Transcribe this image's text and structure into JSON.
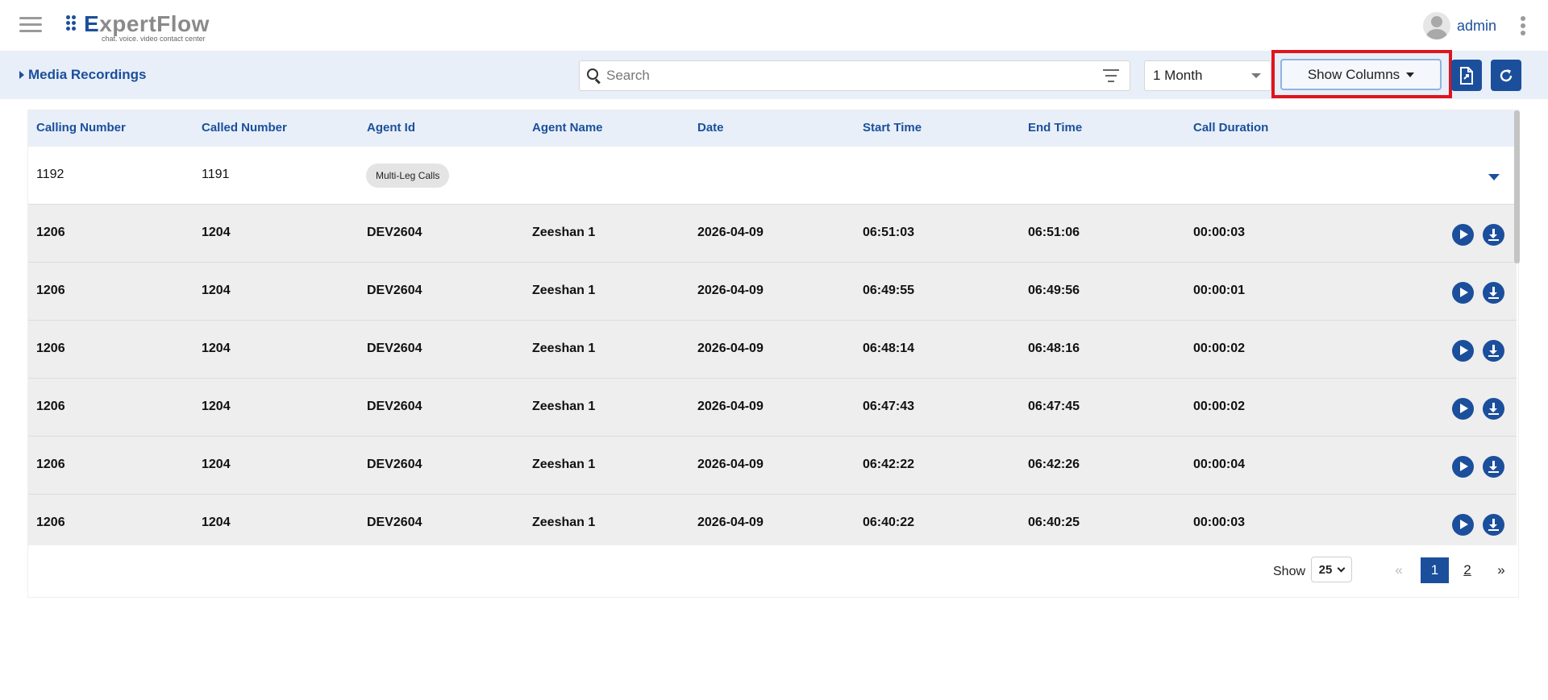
{
  "header": {
    "brand": "ExpertFlow",
    "brand_e": "E",
    "brand_rest": "xpertFlow",
    "tagline": "chat. voice. video contact center",
    "username": "admin"
  },
  "toolbar": {
    "breadcrumb": "Media Recordings",
    "search_placeholder": "Search",
    "period": "1 Month",
    "show_columns": "Show Columns"
  },
  "table": {
    "columns": [
      "Calling Number",
      "Called Number",
      "Agent Id",
      "Agent Name",
      "Date",
      "Start Time",
      "End Time",
      "Call Duration"
    ],
    "group_row": {
      "calling": "1192",
      "called": "1191",
      "tag": "Multi-Leg Calls"
    },
    "rows": [
      {
        "calling": "1206",
        "called": "1204",
        "agent_id": "DEV2604",
        "agent_name": "Zeeshan 1",
        "date": "2026-04-09",
        "start": "06:51:03",
        "end": "06:51:06",
        "duration": "00:00:03"
      },
      {
        "calling": "1206",
        "called": "1204",
        "agent_id": "DEV2604",
        "agent_name": "Zeeshan 1",
        "date": "2026-04-09",
        "start": "06:49:55",
        "end": "06:49:56",
        "duration": "00:00:01"
      },
      {
        "calling": "1206",
        "called": "1204",
        "agent_id": "DEV2604",
        "agent_name": "Zeeshan 1",
        "date": "2026-04-09",
        "start": "06:48:14",
        "end": "06:48:16",
        "duration": "00:00:02"
      },
      {
        "calling": "1206",
        "called": "1204",
        "agent_id": "DEV2604",
        "agent_name": "Zeeshan 1",
        "date": "2026-04-09",
        "start": "06:47:43",
        "end": "06:47:45",
        "duration": "00:00:02"
      },
      {
        "calling": "1206",
        "called": "1204",
        "agent_id": "DEV2604",
        "agent_name": "Zeeshan 1",
        "date": "2026-04-09",
        "start": "06:42:22",
        "end": "06:42:26",
        "duration": "00:00:04"
      },
      {
        "calling": "1206",
        "called": "1204",
        "agent_id": "DEV2604",
        "agent_name": "Zeeshan 1",
        "date": "2026-04-09",
        "start": "06:40:22",
        "end": "06:40:25",
        "duration": "00:00:03"
      }
    ]
  },
  "pagination": {
    "show_label": "Show",
    "page_size": "25",
    "prev": "«",
    "current": "1",
    "page2": "2",
    "next": "»"
  },
  "icons": {
    "menu": "hamburger-icon",
    "profile": "avatar-icon",
    "more": "kebab-icon",
    "search": "search-icon",
    "filter": "filter-icon",
    "export": "export-file-icon",
    "refresh": "refresh-icon",
    "play": "play-icon",
    "download": "download-icon"
  },
  "colors": {
    "accent": "#1b4f9c",
    "toolbar_bg": "#e8eff8",
    "highlight": "#e0141e",
    "row_grey": "#eeeeee"
  }
}
